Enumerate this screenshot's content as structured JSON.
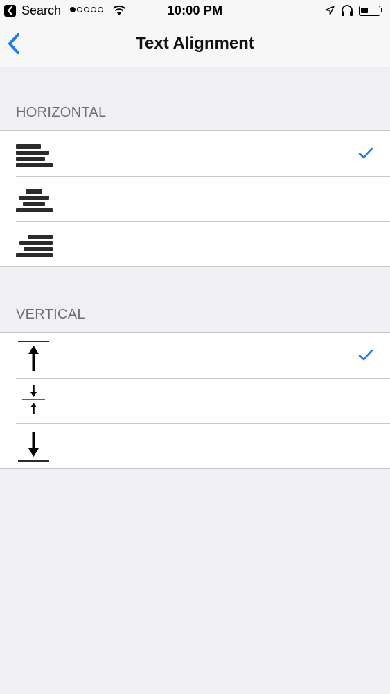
{
  "status_bar": {
    "back_label": "Search",
    "time": "10:00 PM",
    "signal_bars": 1,
    "signal_total": 5,
    "battery_level": 0.4
  },
  "nav": {
    "title": "Text Alignment",
    "back_icon": "chevron-left-icon",
    "accent_color": "#1a7cf4"
  },
  "sections": {
    "horizontal": {
      "header": "HORIZONTAL",
      "options": [
        {
          "icon": "align-left-icon",
          "selected": true
        },
        {
          "icon": "align-center-icon",
          "selected": false
        },
        {
          "icon": "align-right-icon",
          "selected": false
        }
      ]
    },
    "vertical": {
      "header": "VERTICAL",
      "options": [
        {
          "icon": "align-top-icon",
          "selected": true
        },
        {
          "icon": "align-middle-icon",
          "selected": false
        },
        {
          "icon": "align-bottom-icon",
          "selected": false
        }
      ]
    }
  }
}
